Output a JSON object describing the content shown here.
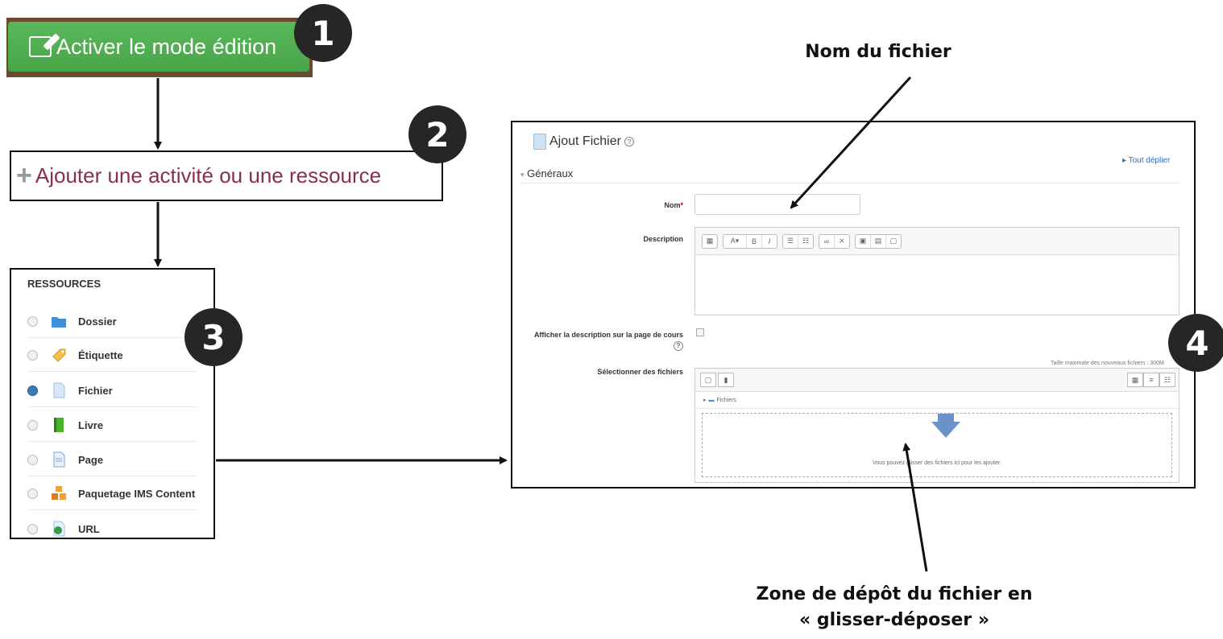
{
  "step1": {
    "badge": "1",
    "button_label": "Activer le mode édition",
    "icon": "edit-icon"
  },
  "step2": {
    "badge": "2",
    "link_label": "Ajouter une activité ou une ressource",
    "icon": "plus-icon"
  },
  "step3": {
    "badge": "3",
    "title": "RESSOURCES",
    "items": [
      {
        "label": "Dossier",
        "icon": "folder-icon",
        "selected": false
      },
      {
        "label": "Étiquette",
        "icon": "label-icon",
        "selected": false
      },
      {
        "label": "Fichier",
        "icon": "file-icon",
        "selected": true
      },
      {
        "label": "Livre",
        "icon": "book-icon",
        "selected": false
      },
      {
        "label": "Page",
        "icon": "page-icon",
        "selected": false
      },
      {
        "label": "Paquetage IMS Content",
        "icon": "package-icon",
        "selected": false
      },
      {
        "label": "URL",
        "icon": "url-icon",
        "selected": false
      }
    ]
  },
  "step4": {
    "badge": "4"
  },
  "form": {
    "title": "Ajout Fichier",
    "expand_all": "Tout déplier",
    "section": "Généraux",
    "name_label": "Nom",
    "name_value": "",
    "description_label": "Description",
    "show_description_label": "Afficher la description sur la page de cours",
    "select_files_label": "Sélectionner des fichiers",
    "max_size_text": "Taille maximale des nouveaux fichiers : 300M",
    "files_folder": "Fichiers",
    "drop_text": "Vous pouvez glisser des fichiers ici pour les ajouter."
  },
  "annotations": {
    "file_name": "Nom du fichier",
    "drop_zone_line1": "Zone de dépôt du fichier en",
    "drop_zone_line2": "« glisser-déposer »"
  },
  "colors": {
    "edit_button": "#5cb85c",
    "link": "#8a2f4a",
    "badge": "#262626"
  }
}
